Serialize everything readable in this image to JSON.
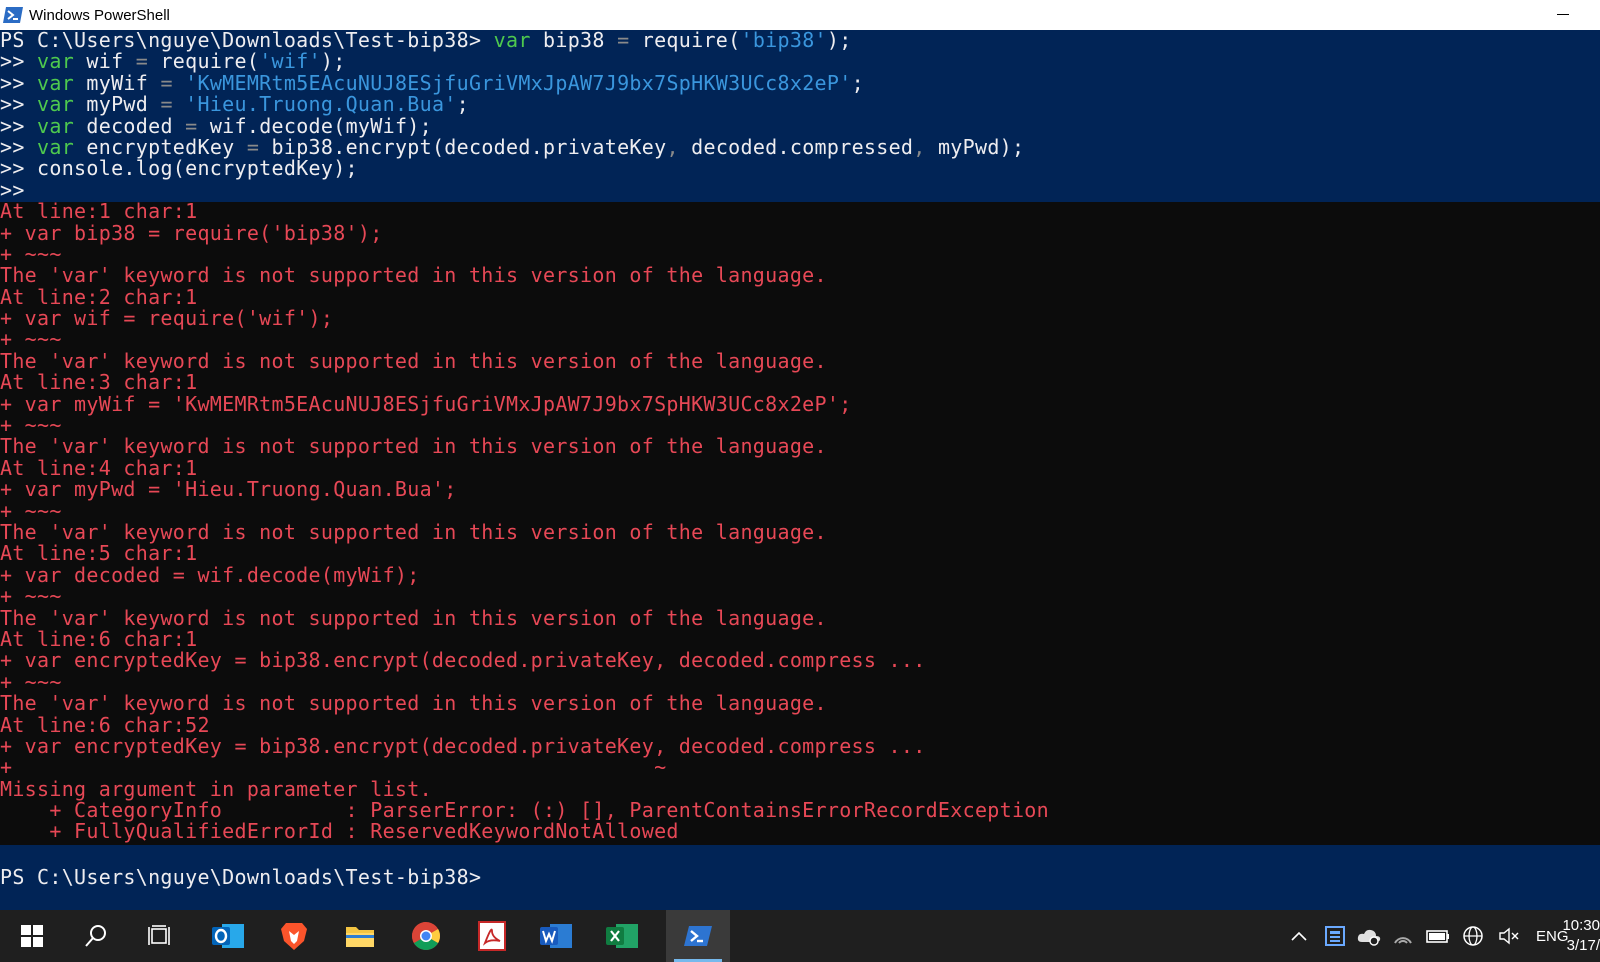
{
  "window": {
    "title": "Windows PowerShell"
  },
  "command_block": {
    "prompt": "PS C:\\Users\\nguye\\Downloads\\Test-bip38> ",
    "continuation": ">> ",
    "lines": [
      [
        {
          "t": "var",
          "c": "kw"
        },
        {
          "t": " bip38 "
        },
        {
          "t": "=",
          "c": "op"
        },
        {
          "t": " require("
        },
        {
          "t": "'bip38'",
          "c": "str"
        },
        {
          "t": ");"
        }
      ],
      [
        {
          "t": "var",
          "c": "kw"
        },
        {
          "t": " wif "
        },
        {
          "t": "=",
          "c": "op"
        },
        {
          "t": " require("
        },
        {
          "t": "'wif'",
          "c": "str"
        },
        {
          "t": ");"
        }
      ],
      [
        {
          "t": "var",
          "c": "kw"
        },
        {
          "t": " myWif "
        },
        {
          "t": "=",
          "c": "op"
        },
        {
          "t": " "
        },
        {
          "t": "'KwMEMRtm5EAcuNUJ8ESjfuGriVMxJpAW7J9bx7SpHKW3UCc8x2eP'",
          "c": "str"
        },
        {
          "t": ";"
        }
      ],
      [
        {
          "t": "var",
          "c": "kw"
        },
        {
          "t": " myPwd "
        },
        {
          "t": "=",
          "c": "op"
        },
        {
          "t": " "
        },
        {
          "t": "'Hieu.Truong.Quan.Bua'",
          "c": "str"
        },
        {
          "t": ";"
        }
      ],
      [
        {
          "t": "var",
          "c": "kw"
        },
        {
          "t": " decoded "
        },
        {
          "t": "=",
          "c": "op"
        },
        {
          "t": " wif.decode(myWif);"
        }
      ],
      [
        {
          "t": "var",
          "c": "kw"
        },
        {
          "t": " encryptedKey "
        },
        {
          "t": "=",
          "c": "op"
        },
        {
          "t": " bip38.encrypt(decoded.privateKey"
        },
        {
          "t": ",",
          "c": "op"
        },
        {
          "t": " decoded.compressed"
        },
        {
          "t": ",",
          "c": "op"
        },
        {
          "t": " myPwd);"
        }
      ],
      [
        {
          "t": "console.log(encryptedKey);"
        }
      ],
      []
    ]
  },
  "error_lines": [
    "At line:1 char:1",
    "+ var bip38 = require('bip38');",
    "+ ~~~",
    "The 'var' keyword is not supported in this version of the language.",
    "At line:2 char:1",
    "+ var wif = require('wif');",
    "+ ~~~",
    "The 'var' keyword is not supported in this version of the language.",
    "At line:3 char:1",
    "+ var myWif = 'KwMEMRtm5EAcuNUJ8ESjfuGriVMxJpAW7J9bx7SpHKW3UCc8x2eP';",
    "+ ~~~",
    "The 'var' keyword is not supported in this version of the language.",
    "At line:4 char:1",
    "+ var myPwd = 'Hieu.Truong.Quan.Bua';",
    "+ ~~~",
    "The 'var' keyword is not supported in this version of the language.",
    "At line:5 char:1",
    "+ var decoded = wif.decode(myWif);",
    "+ ~~~",
    "The 'var' keyword is not supported in this version of the language.",
    "At line:6 char:1",
    "+ var encryptedKey = bip38.encrypt(decoded.privateKey, decoded.compress ...",
    "+ ~~~",
    "The 'var' keyword is not supported in this version of the language.",
    "At line:6 char:52",
    "+ var encryptedKey = bip38.encrypt(decoded.privateKey, decoded.compress ...",
    "+                                                    ~",
    "Missing argument in parameter list.",
    "    + CategoryInfo          : ParserError: (:) [], ParentContainsErrorRecordException",
    "    + FullyQualifiedErrorId : ReservedKeywordNotAllowed"
  ],
  "final_prompt": "PS C:\\Users\\nguye\\Downloads\\Test-bip38>",
  "taskbar": {
    "apps": [
      {
        "name": "start-button",
        "icon": "windows-logo-icon"
      },
      {
        "name": "search-button",
        "icon": "search-icon"
      },
      {
        "name": "task-view-button",
        "icon": "task-view-icon"
      },
      {
        "name": "outlook-app",
        "icon": "outlook-icon"
      },
      {
        "name": "brave-app",
        "icon": "brave-icon"
      },
      {
        "name": "file-explorer-app",
        "icon": "folder-icon"
      },
      {
        "name": "chrome-app",
        "icon": "chrome-icon"
      },
      {
        "name": "acrobat-app",
        "icon": "acrobat-icon"
      },
      {
        "name": "word-app",
        "icon": "word-icon"
      },
      {
        "name": "excel-app",
        "icon": "excel-icon"
      },
      {
        "name": "powershell-app",
        "icon": "powershell-icon"
      }
    ],
    "tray": {
      "language": "ENG",
      "time": "10:30",
      "date": "3/17/"
    }
  },
  "colors": {
    "ps_blue": "#012456",
    "console_black": "#0c0c0c",
    "error_red": "#e74856",
    "keyword_green": "#4ec94e",
    "string_blue": "#3a96dd",
    "operator_gray": "#8a8a8a"
  }
}
